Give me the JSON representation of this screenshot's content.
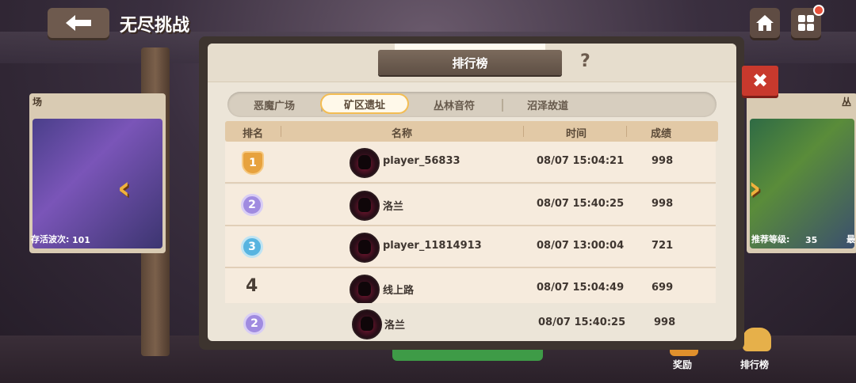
{
  "header": {
    "title": "无尽挑战"
  },
  "side_left": {
    "name": "场",
    "wave_label": "存活波次:",
    "wave_value": "101"
  },
  "side_right": {
    "name": "丛",
    "level_label": "推荐等级:",
    "level_value": "35",
    "extra": "最"
  },
  "modal": {
    "title": "排行榜",
    "help": "?",
    "close": "✖",
    "tabs": [
      {
        "label": "恶魔广场",
        "active": false
      },
      {
        "label": "矿区遗址",
        "active": true
      },
      {
        "label": "丛林音符",
        "active": false
      },
      {
        "label": "沼泽故道",
        "active": false
      }
    ],
    "columns": {
      "rank": "排名",
      "name": "名称",
      "time": "时间",
      "score": "成绩"
    },
    "rows": [
      {
        "rank": "1",
        "name": "player_56833",
        "time": "08/07 15:04:21",
        "score": "998"
      },
      {
        "rank": "2",
        "name": "洛兰",
        "time": "08/07 15:40:25",
        "score": "998"
      },
      {
        "rank": "3",
        "name": "player_11814913",
        "time": "08/07 13:00:04",
        "score": "721"
      },
      {
        "rank": "4",
        "name": "线上路",
        "time": "08/07 15:04:49",
        "score": "699"
      },
      {
        "rank": "2",
        "name": "洛兰",
        "time": "08/07 15:40:25",
        "score": "998"
      }
    ]
  },
  "bottom": {
    "reward_label": "奖励",
    "leaderboard_label": "排行榜"
  }
}
